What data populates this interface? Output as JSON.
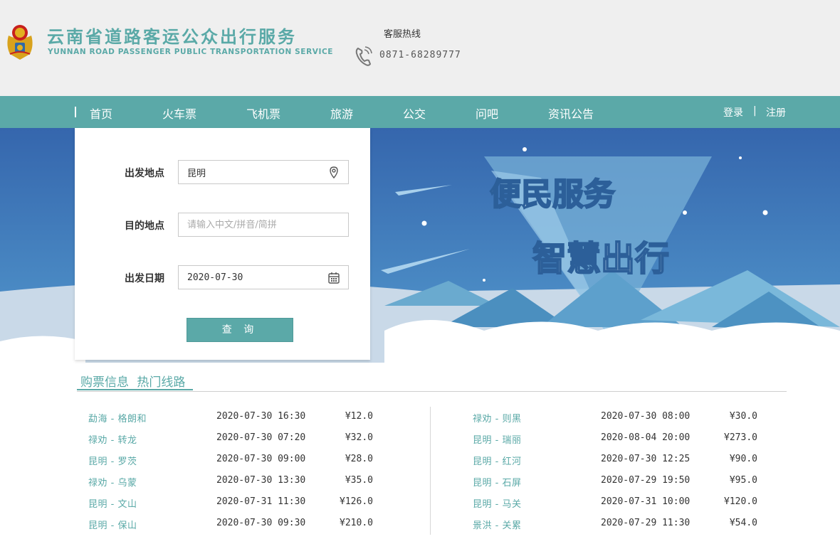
{
  "header": {
    "title": "云南省道路客运公众出行服务",
    "subtitle": "YUNNAN ROAD PASSENGER PUBLIC TRANSPORTATION SERVICE",
    "hotline_label": "客服热线",
    "hotline_number": "0871-68289777",
    "emblem_icon": "national-emblem-icon",
    "phone_icon": "phone-icon"
  },
  "nav": {
    "items": [
      "首页",
      "火车票",
      "飞机票",
      "旅游",
      "公交",
      "问吧",
      "资讯公告"
    ],
    "login": "登录",
    "separator": "|",
    "register": "注册"
  },
  "banner": {
    "slogan_1": "便民服务",
    "slogan_2": "智慧出行"
  },
  "search": {
    "from_label": "出发地点",
    "from_value": "昆明",
    "to_label": "目的地点",
    "to_placeholder": "请输入中文/拼音/简拼",
    "date_label": "出发日期",
    "date_value": "2020-07-30",
    "button_label": "查 询",
    "location_icon": "map-pin-icon",
    "calendar_icon": "calendar-icon"
  },
  "routes": {
    "tabs": [
      "购票信息",
      "热门线路"
    ],
    "left": [
      {
        "name": "勐海 - 格朗和",
        "datetime": "2020-07-30  16:30",
        "price": "¥12.0"
      },
      {
        "name": "禄劝 - 转龙",
        "datetime": "2020-07-30  07:20",
        "price": "¥32.0"
      },
      {
        "name": "昆明 - 罗茨",
        "datetime": "2020-07-30  09:00",
        "price": "¥28.0"
      },
      {
        "name": "禄劝 - 乌蒙",
        "datetime": "2020-07-30  13:30",
        "price": "¥35.0"
      },
      {
        "name": "昆明 - 文山",
        "datetime": "2020-07-31  11:30",
        "price": "¥126.0"
      },
      {
        "name": "昆明 - 保山",
        "datetime": "2020-07-30  09:30",
        "price": "¥210.0"
      }
    ],
    "right": [
      {
        "name": "禄劝 - 则黑",
        "datetime": "2020-07-30  08:00",
        "price": "¥30.0"
      },
      {
        "name": "昆明 - 瑞丽",
        "datetime": "2020-08-04  20:00",
        "price": "¥273.0"
      },
      {
        "name": "昆明 - 红河",
        "datetime": "2020-07-30  12:25",
        "price": "¥90.0"
      },
      {
        "name": "昆明 - 石屏",
        "datetime": "2020-07-29  19:50",
        "price": "¥95.0"
      },
      {
        "name": "昆明 - 马关",
        "datetime": "2020-07-31  10:00",
        "price": "¥120.0"
      },
      {
        "name": "景洪 - 关累",
        "datetime": "2020-07-29  11:30",
        "price": "¥54.0"
      }
    ]
  },
  "colors": {
    "accent": "#5ba9a8",
    "banner_sky": "#3a78b4"
  }
}
